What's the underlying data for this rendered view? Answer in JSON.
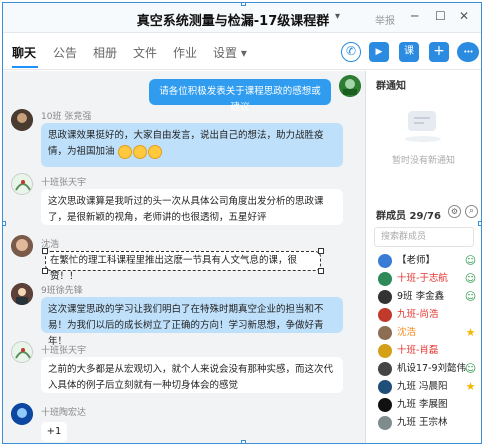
{
  "window": {
    "title": "真空系统测量与检漏-17级课程群",
    "title_caret": "▾",
    "report_label": "举报",
    "minimize": "─",
    "maximize": "☐",
    "close": "✕"
  },
  "tabs": [
    {
      "label": "聊天"
    },
    {
      "label": "公告"
    },
    {
      "label": "相册"
    },
    {
      "label": "文件"
    },
    {
      "label": "作业"
    },
    {
      "label": "设置 ▾"
    }
  ],
  "toolbar": {
    "phone": "✆",
    "video": "▶",
    "classroom": "课",
    "add": "+",
    "more": "•••"
  },
  "messages": [
    {
      "text": "请各位积极发表关于课程思政的感想或建议"
    },
    {
      "sender": "10班 张竞强",
      "text": "思政课效果挺好的，大家自由发言，说出自己的想法，助力战胜疫情，为祖国加油"
    },
    {
      "sender": "十班张天宇",
      "text": "这次思政课算是我听过的头一次从具体公司角度出发分析的思政课了，是很新颖的视角，老师讲的也很透彻，五星好评"
    },
    {
      "sender": "沈浩",
      "text": "在繁忙的理工科课程里推出这麽一节具有人文气息的课，很赞！！"
    },
    {
      "sender": "9班徐先锋",
      "text": "这次课堂思政的学习让我们明白了在特殊时期真空企业的担当和不易！为我们以后的成长树立了正确的方向！学习新思想，争做好青年！"
    },
    {
      "sender": "十班张天宇",
      "text": "之前的大多都是从宏观切入，就个人来说会没有那种实感，而这次代入具体的例子后立刻就有一种切身体会的感觉"
    },
    {
      "sender": "十班陶宏达",
      "text": "+1"
    }
  ],
  "sidebar": {
    "notice_title": "群通知",
    "notice_empty": "暂时没有新通知",
    "members_title": "群成员 29/76",
    "search_placeholder": "搜索群成员",
    "members": [
      {
        "name": "【老师】",
        "color": "#222222",
        "badge": "person",
        "avatar_color": "#3a7bd5"
      },
      {
        "name": "十班-于志航",
        "color": "#e5322d",
        "badge": "person",
        "avatar_color": "#2e8b57"
      },
      {
        "name": "9班 李金鑫",
        "color": "#222222",
        "badge": "person",
        "avatar_color": "#333333"
      },
      {
        "name": "九班-尚浩",
        "color": "#e5322d",
        "badge": "",
        "avatar_color": "#c0392b"
      },
      {
        "name": "沈浩",
        "color": "#f38b1e",
        "badge": "star",
        "avatar_color": "#8e6e53"
      },
      {
        "name": "十班-肖磊",
        "color": "#e5322d",
        "badge": "",
        "avatar_color": "#d4a017"
      },
      {
        "name": "机设17-9刘懿伟",
        "color": "#222222",
        "badge": "person",
        "avatar_color": "#444444"
      },
      {
        "name": "九班 冯晨阳",
        "color": "#222222",
        "badge": "star",
        "avatar_color": "#1f4e79"
      },
      {
        "name": "九班 李展图",
        "color": "#222222",
        "badge": "",
        "avatar_color": "#111111"
      },
      {
        "name": "九班 王宗林",
        "color": "#222222",
        "badge": "",
        "avatar_color": "#7f8c8d"
      }
    ]
  },
  "colors": {
    "accent": "#2a8be0",
    "sent_bubble": "#2f9cf0",
    "recv_bubble_blue": "#bfe0fb",
    "chat_bg": "#f2f3f5"
  }
}
